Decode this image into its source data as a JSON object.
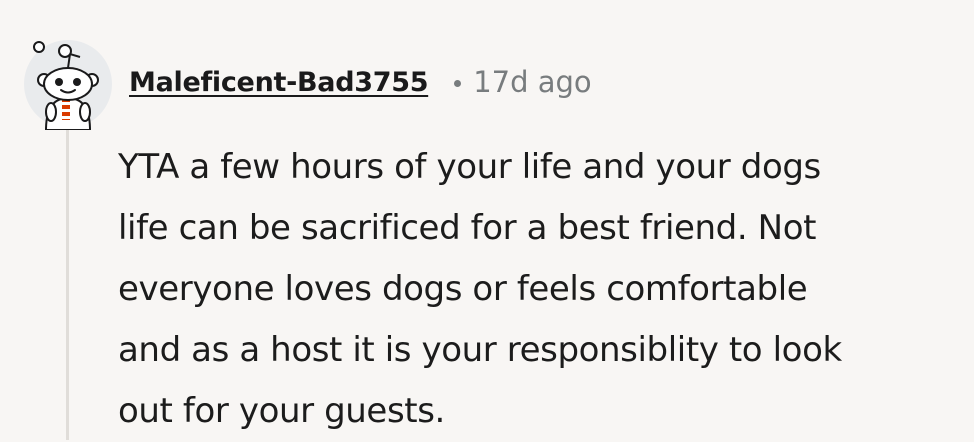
{
  "comment": {
    "author": "Maleficent-Bad3755",
    "separator": "•",
    "timestamp": "17d ago",
    "body_lines": [
      "YTA a few hours of your life and your dogs",
      "life can be sacrificed for a best friend. Not",
      "everyone loves dogs or feels comfortable",
      "and as a host it is your responsiblity to look",
      "out for your guests."
    ]
  },
  "colors": {
    "background": "#f8f6f4",
    "username": "#1a1a1b",
    "meta": "#787c7e",
    "body": "#1c1c1c",
    "thread_line": "#e0ddd9"
  },
  "icons": {
    "avatar": "reddit-snoo-avatar-icon"
  }
}
